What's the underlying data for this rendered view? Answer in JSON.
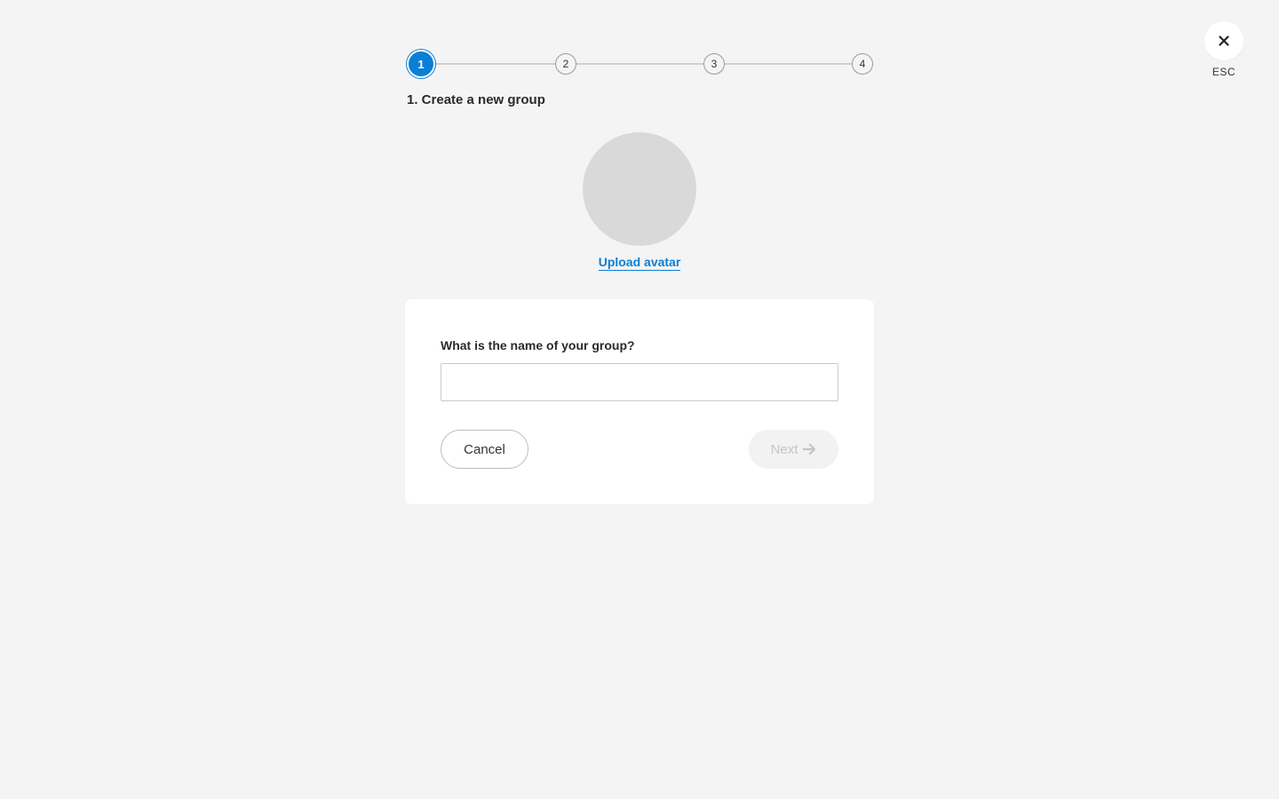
{
  "close": {
    "icon": "close-icon",
    "label": "ESC"
  },
  "stepper": {
    "steps": [
      "1",
      "2",
      "3",
      "4"
    ],
    "active_step": 1,
    "active_color": "#0a7fd6"
  },
  "step_title": "1. Create a new group",
  "avatar": {
    "upload_label": "Upload avatar"
  },
  "form": {
    "name_label": "What is the name of your group?",
    "name_value": "",
    "name_placeholder": "",
    "cancel_label": "Cancel",
    "next_label": "Next",
    "next_icon": "arrow-right-icon"
  }
}
